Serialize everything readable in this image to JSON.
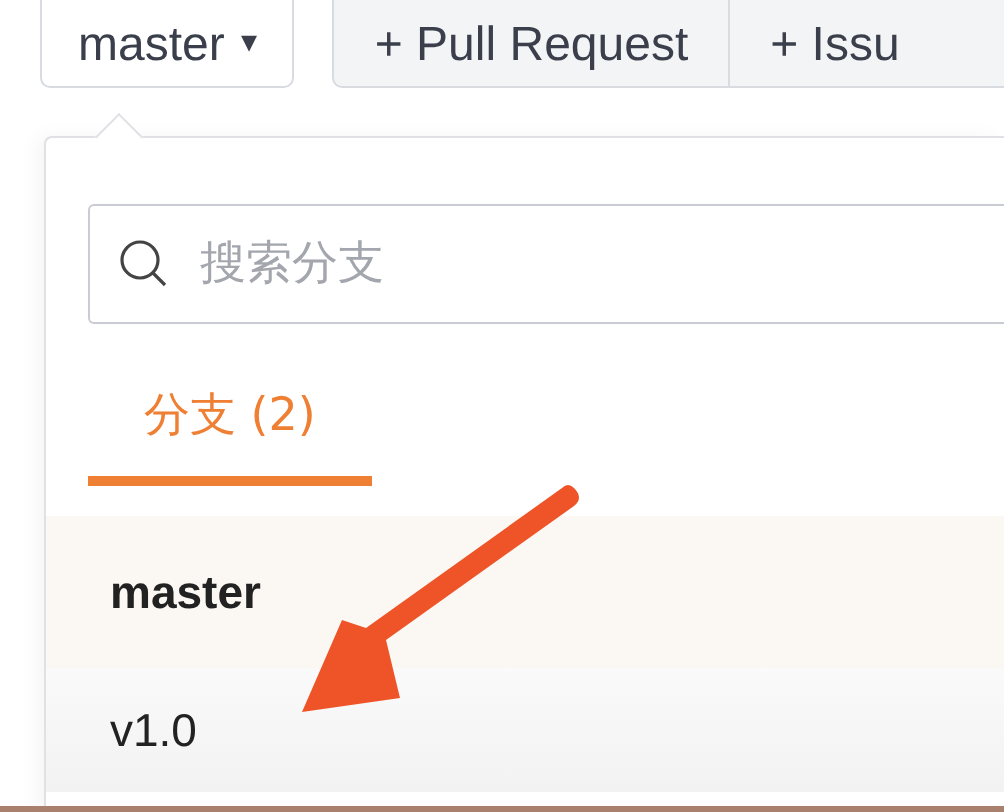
{
  "toolbar": {
    "branch_button": {
      "label": "master",
      "caret": "▾"
    },
    "buttons": [
      {
        "label": "+ Pull Request"
      },
      {
        "label": "+ Issu"
      }
    ]
  },
  "branch_popup": {
    "search": {
      "placeholder": "搜索分支"
    },
    "tabs": [
      {
        "label": "分支 (2)",
        "selected": true
      }
    ],
    "branches": [
      {
        "name": "master",
        "selected": true
      },
      {
        "name": "v1.0",
        "selected": false
      }
    ]
  },
  "annotation": {
    "kind": "arrow"
  }
}
